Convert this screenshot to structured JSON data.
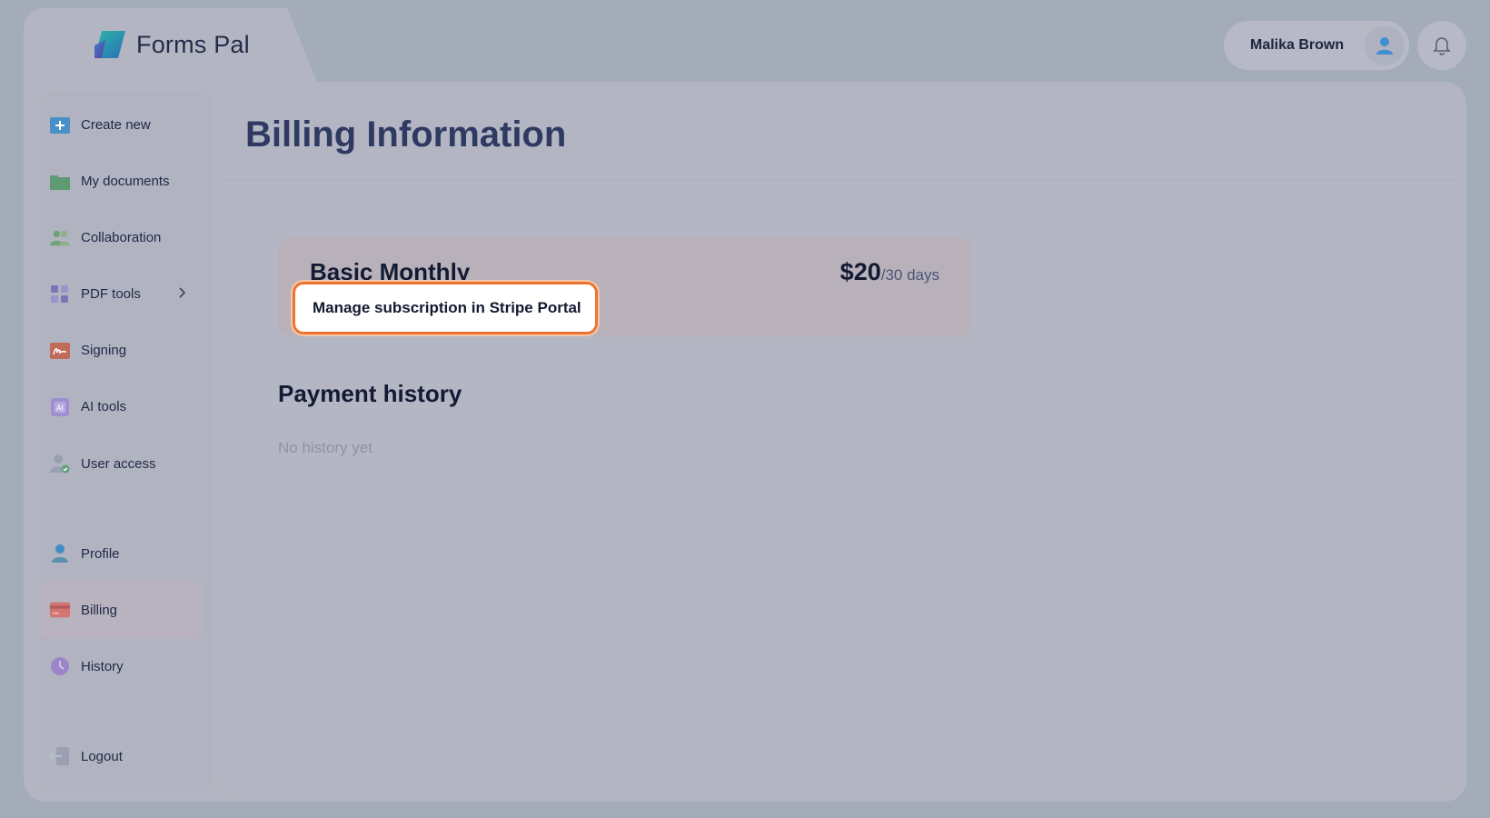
{
  "brand": {
    "name_part1": "Forms",
    "name_part2": "Pal"
  },
  "header": {
    "user_name": "Malika Brown"
  },
  "sidebar": {
    "items": [
      {
        "label": "Create new",
        "icon": "plus-square-icon"
      },
      {
        "label": "My documents",
        "icon": "folder-icon"
      },
      {
        "label": "Collaboration",
        "icon": "users-icon"
      },
      {
        "label": "PDF tools",
        "icon": "grid-icon",
        "has_submenu": true
      },
      {
        "label": "Signing",
        "icon": "signature-icon"
      },
      {
        "label": "AI tools",
        "icon": "ai-icon"
      },
      {
        "label": "User access",
        "icon": "user-check-icon"
      }
    ],
    "account_items": [
      {
        "label": "Profile",
        "icon": "user-icon"
      },
      {
        "label": "Billing",
        "icon": "credit-card-icon",
        "active": true
      },
      {
        "label": "History",
        "icon": "clock-icon"
      }
    ],
    "logout": {
      "label": "Logout",
      "icon": "logout-icon"
    }
  },
  "main": {
    "title": "Billing Information",
    "plan": {
      "name": "Basic Monthly",
      "price": "$20",
      "period": "/30 days",
      "manage_label": "Manage subscription in Stripe Portal"
    },
    "payment_history": {
      "title": "Payment history",
      "empty_text": "No history yet"
    }
  },
  "colors": {
    "accent_highlight": "#ee7333",
    "title": "#2f3a62",
    "text_dark": "#131a33"
  }
}
